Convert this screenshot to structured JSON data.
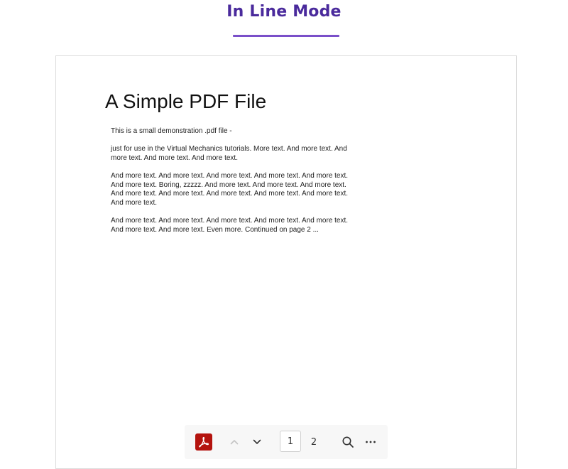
{
  "header": {
    "title": "In Line Mode",
    "accent_color": "#4a2a9c",
    "underline_color": "#7a4fc9"
  },
  "document": {
    "heading": "A Simple PDF File",
    "paragraphs": [
      "This is a small demonstration .pdf file -",
      "just for use in the Virtual Mechanics tutorials. More text. And more text. And more text. And more text. And more text.",
      "And more text. And more text. And more text. And more text. And more text. And more text. Boring, zzzzz. And more text. And more text. And more text. And more text. And more text. And more text. And more text. And more text. And more text.",
      "And more text. And more text. And more text. And more text. And more text. And more text. And more text. Even more. Continued on page 2 ..."
    ]
  },
  "toolbar": {
    "logo_icon": "adobe-pdf-icon",
    "logo_color": "#b4130e",
    "prev_icon": "chevron-up-icon",
    "next_icon": "chevron-down-icon",
    "current_page": "1",
    "total_pages": "2",
    "search_icon": "search-icon",
    "more_icon": "more-horizontal-icon"
  }
}
